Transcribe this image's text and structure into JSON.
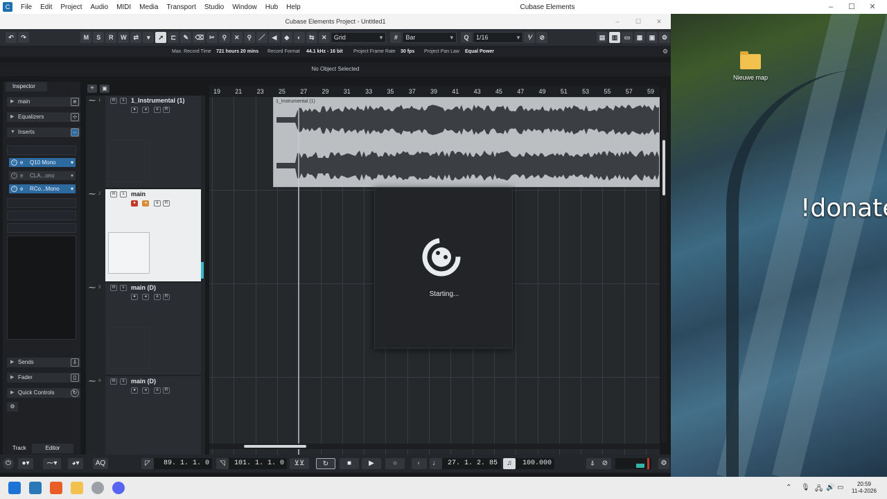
{
  "os_menu": [
    "File",
    "Edit",
    "Project",
    "Audio",
    "MIDI",
    "Media",
    "Transport",
    "Studio",
    "Window",
    "Hub",
    "Help"
  ],
  "app_title": "Cubase Elements",
  "window_title": "Cubase Elements Project - Untitled1",
  "toolbar": {
    "m": "M",
    "s": "S",
    "r": "R",
    "w": "W",
    "snap_type": "Grid",
    "grid_type": "Bar",
    "quantize": "1/16"
  },
  "info_line": {
    "max_record_time_label": "Max. Record Time",
    "max_record_time": "721 hours 20 mins",
    "record_format_label": "Record Format",
    "record_format": "44.1 kHz - 16 bit",
    "frame_rate_label": "Project Frame Rate",
    "frame_rate": "30 fps",
    "pan_law_label": "Project Pan Law",
    "pan_law": "Equal Power"
  },
  "selection_line": "No Object Selected",
  "inspector": {
    "tab": "Inspector",
    "track_name": "main",
    "sections": {
      "equalizers": "Equalizers",
      "inserts": "Inserts",
      "sends": "Sends",
      "fader": "Fader",
      "quick_controls": "Quick Controls"
    },
    "plugins": [
      "Q10 Mono",
      "CLA...ono",
      "RCo...Mono"
    ],
    "bottom_tabs": [
      "Track",
      "Editor"
    ]
  },
  "tracks": [
    {
      "num": "1",
      "name": "1_Instrumental (1)"
    },
    {
      "num": "2",
      "name": "main"
    },
    {
      "num": "3",
      "name": "main (D)"
    },
    {
      "num": "4",
      "name": "main (D)"
    }
  ],
  "ruler_bars": [
    "19",
    "21",
    "23",
    "25",
    "27",
    "29",
    "31",
    "33",
    "35",
    "37",
    "39",
    "41",
    "43",
    "45",
    "47",
    "49",
    "51",
    "53",
    "55",
    "57",
    "59"
  ],
  "event_name": "1_Instrumental (1)",
  "splash": {
    "status": "Starting..."
  },
  "transport": {
    "left_locator": "89. 1. 1.   0",
    "right_locator": "101. 1. 1.   0",
    "position": "27. 1. 2.  85",
    "tempo": "100.000",
    "aq": "AQ"
  },
  "desktop": {
    "folder": "Nieuwe map",
    "wallpaper_text": "!donate"
  },
  "clock": {
    "time": "20:59",
    "date": "11-4-2026"
  },
  "colors": {
    "accent": "#2d6a9f",
    "record": "#c0392b",
    "monitor": "#d78c3a"
  }
}
